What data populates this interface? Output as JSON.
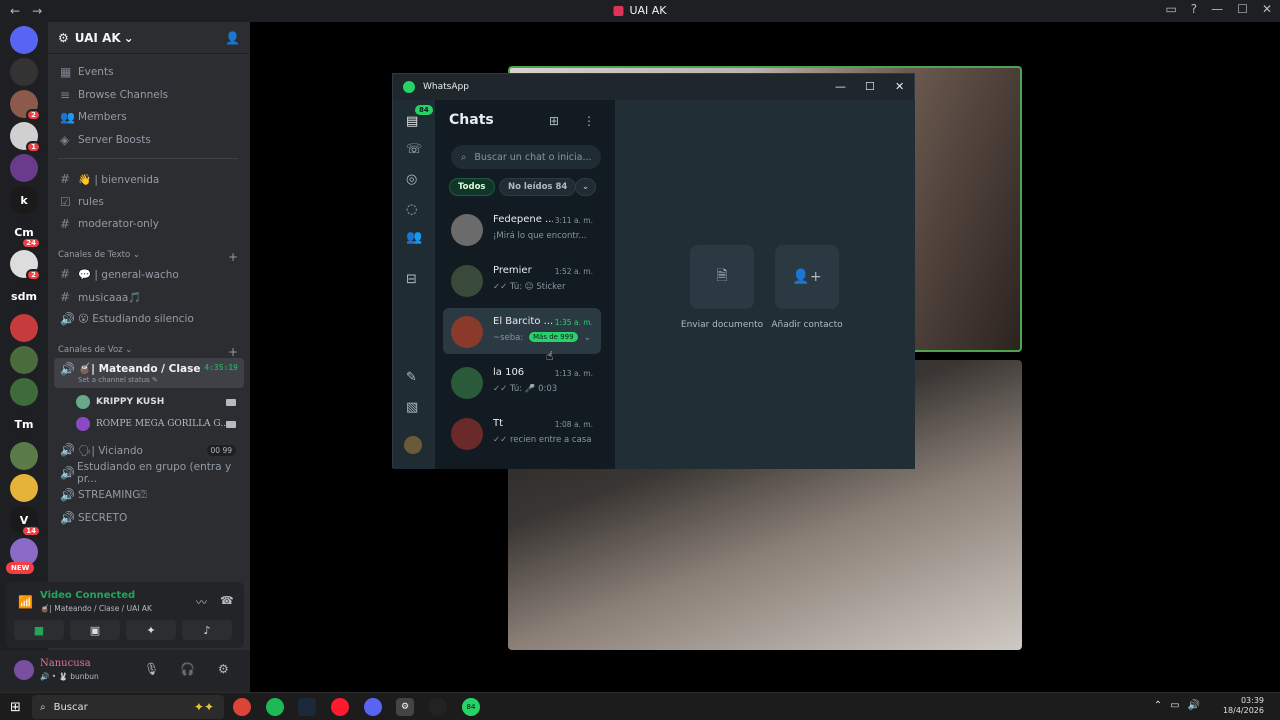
{
  "window": {
    "title": "UAI AK",
    "nav_back": "←",
    "nav_fwd": "→",
    "controls": [
      "▭",
      "?",
      "—",
      "☐",
      "✕"
    ]
  },
  "servers": [
    {
      "label": "",
      "badge": "",
      "color": "#5865f2"
    },
    {
      "label": "",
      "badge": "",
      "color": "#333"
    },
    {
      "label": "",
      "badge": "2",
      "color": "#8b5a4a"
    },
    {
      "label": "",
      "badge": "1",
      "color": "#d0d0d0"
    },
    {
      "label": "",
      "badge": "",
      "color": "#6a3b8c"
    },
    {
      "label": "k",
      "badge": "",
      "color": "#1a1a1a"
    },
    {
      "label": "Cm",
      "badge": "24",
      "color": "#1e1f22"
    },
    {
      "label": "",
      "badge": "2",
      "color": "#ddd"
    },
    {
      "label": "sdm",
      "badge": "",
      "color": "#1e1f22"
    },
    {
      "label": "",
      "badge": "",
      "color": "#c63b3b"
    },
    {
      "label": "",
      "badge": "",
      "color": "#4a6b3b"
    },
    {
      "label": "",
      "badge": "",
      "color": "#3f6b3a"
    },
    {
      "label": "Tm",
      "badge": "",
      "color": "#1e1f22"
    },
    {
      "label": "",
      "badge": "",
      "color": "#5a7a4a"
    },
    {
      "label": "",
      "badge": "",
      "color": "#e5b23a"
    },
    {
      "label": "V",
      "badge": "14",
      "color": "#1a1a1a"
    },
    {
      "label": "",
      "badge": "",
      "color": "#8a6ac4"
    }
  ],
  "new_badge": "NEW",
  "server_name": "UAI AK",
  "channels": {
    "events": "Events",
    "browse": "Browse Channels",
    "members": "Members",
    "boosts": "Server Boosts",
    "bienvenida": "👋 | bienvenida",
    "rules": "rules",
    "moderator": "moderator-only",
    "cat_text": "Canales de Texto",
    "general": "💬 | general-wacho",
    "musica": "musicaaa🎵",
    "estudiando_silencio": "😮 Estudiando silencio",
    "cat_voice": "Canales de Voz",
    "mateando": "🧉| Mateando / Clase",
    "mateando_time": "4:35:19",
    "mateando_status": "Set a channel status ✎",
    "user1": "KRIPPY KUSH",
    "user2": "ROMPE MEGA GORILLA G...",
    "viciando": "🗣| Viciando",
    "viciando_pill": "00   99",
    "estudiando_grupo": "Estudiando en grupo (entra y pr...",
    "streaming": "STREAMING⍰",
    "secreto": "SECRETO"
  },
  "voice": {
    "title": "Video Connected",
    "sub": "🧉| Mateando / Clase / UAI AK"
  },
  "user": {
    "name": "Nanucusa",
    "status": "🔊 • 🐰 bunbun"
  },
  "whatsapp": {
    "app_title": "WhatsApp",
    "badge": "84",
    "list_title": "Chats",
    "search_placeholder": "Buscar un chat o inicia...",
    "filter_all": "Todos",
    "filter_unread": "No leídos 84",
    "chats": [
      {
        "name": "Fedepene ...",
        "time": "3:11 a. m.",
        "msg": "¡Mirá lo que encontr...",
        "color": "#6b6b6b"
      },
      {
        "name": "Premier",
        "time": "1:52 a. m.",
        "msg": "✓✓ Tú: ☺ Sticker",
        "color": "#3a4a3a"
      },
      {
        "name": "El Barcito ...",
        "time": "1:35 a. m.",
        "msg": "~seba:",
        "more": "Más de 999",
        "color": "#8a3a2a"
      },
      {
        "name": "la 106",
        "time": "1:13 a. m.",
        "msg": "✓✓ Tú: 🎤 0:03",
        "color": "#2a5a3a"
      },
      {
        "name": "Tt",
        "time": "1:08 a. m.",
        "msg": "✓✓ recien entre a casa",
        "color": "#6a2a2a"
      }
    ],
    "action_doc": "Enviar documento",
    "action_contact": "Añadir contacto"
  },
  "taskbar": {
    "search": "Buscar",
    "wa_badge": "84",
    "time": "03:39",
    "date": "18/4/2026"
  }
}
